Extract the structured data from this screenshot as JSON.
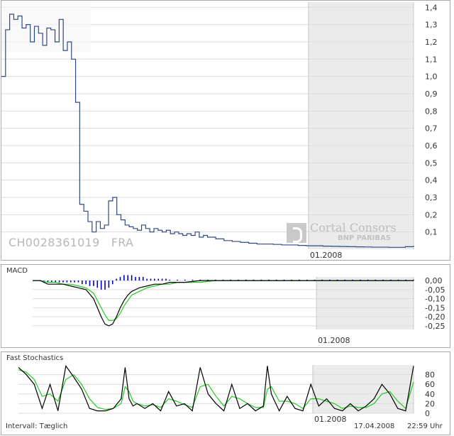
{
  "instrument": {
    "isin": "CH0028361019",
    "exchange": "FRA"
  },
  "brand": {
    "name": "Cortal Consors",
    "sub": "BNP PARIBAS"
  },
  "footer": {
    "interval": "Intervall: Tæglich",
    "date": "17.04.2008",
    "time": "22:59 Uhr"
  },
  "colors": {
    "price": "#2e4a86",
    "macd": "#000000",
    "signal": "#22cc22",
    "hist": "#0000cc",
    "stoch_k": "#000000",
    "stoch_d": "#22cc22",
    "future": "#ebebeb"
  },
  "chart_data": [
    {
      "type": "line",
      "name": "price",
      "x_start": 0,
      "x_end": 100,
      "date_marker": {
        "x": 74.5,
        "label": "01.2008"
      },
      "ylim": [
        0,
        1.43
      ],
      "yticks": [
        "0,1",
        "0,2",
        "0,3",
        "0,4",
        "0,5",
        "0,6",
        "0,7",
        "0,8",
        "0,9",
        "1,0",
        "1,1",
        "1,2",
        "1,3",
        "1,4"
      ],
      "ytick_values": [
        0.1,
        0.2,
        0.3,
        0.4,
        0.5,
        0.6,
        0.7,
        0.8,
        0.9,
        1.0,
        1.1,
        1.2,
        1.3,
        1.4
      ],
      "x": [
        0,
        1,
        2,
        3,
        4,
        5,
        6,
        7,
        8,
        9,
        10,
        11,
        12,
        13,
        14,
        15,
        16,
        17,
        18,
        19,
        20,
        21,
        22,
        23,
        24,
        25,
        26,
        27,
        28,
        29,
        30,
        31,
        32,
        33,
        34,
        35,
        36,
        37,
        38,
        39,
        40,
        41,
        42,
        43,
        44,
        45,
        46,
        47,
        48,
        49,
        50,
        52,
        54,
        56,
        58,
        60,
        62,
        64,
        66,
        68,
        70,
        72,
        74,
        76,
        78,
        80,
        82,
        84,
        86,
        88,
        90,
        92,
        94,
        96,
        98,
        100
      ],
      "values": [
        1.0,
        1.27,
        1.36,
        1.33,
        1.35,
        1.28,
        1.3,
        1.2,
        1.29,
        1.25,
        1.18,
        1.28,
        1.27,
        1.2,
        1.33,
        1.15,
        1.2,
        1.1,
        0.85,
        0.26,
        0.22,
        0.16,
        0.1,
        0.16,
        0.12,
        0.14,
        0.28,
        0.3,
        0.2,
        0.17,
        0.14,
        0.13,
        0.12,
        0.11,
        0.14,
        0.12,
        0.1,
        0.12,
        0.11,
        0.1,
        0.11,
        0.09,
        0.1,
        0.09,
        0.08,
        0.09,
        0.08,
        0.1,
        0.07,
        0.08,
        0.07,
        0.06,
        0.05,
        0.045,
        0.04,
        0.035,
        0.03,
        0.03,
        0.028,
        0.025,
        0.025,
        0.022,
        0.02,
        0.02,
        0.018,
        0.017,
        0.016,
        0.015,
        0.014,
        0.013,
        0.012,
        0.012,
        0.011,
        0.011,
        0.015,
        0.02
      ]
    },
    {
      "type": "line",
      "name": "MACD",
      "title": "MACD",
      "ylim": [
        -0.27,
        0.02
      ],
      "yticks": [
        "0,00",
        "-0,05",
        "-0,10",
        "-0,15",
        "-0,20",
        "-0,25"
      ],
      "ytick_values": [
        0.0,
        -0.05,
        -0.1,
        -0.15,
        -0.2,
        -0.25
      ],
      "x": [
        0,
        2,
        4,
        6,
        8,
        10,
        12,
        14,
        16,
        17,
        18,
        19,
        20,
        21,
        22,
        23,
        24,
        25,
        26,
        27,
        28,
        30,
        32,
        34,
        36,
        38,
        40,
        44,
        48,
        52,
        56,
        60,
        66,
        72,
        78,
        84,
        90,
        96,
        100
      ],
      "macd": [
        0.0,
        0.0,
        -0.02,
        -0.02,
        -0.02,
        -0.03,
        -0.04,
        -0.05,
        -0.1,
        -0.15,
        -0.2,
        -0.24,
        -0.25,
        -0.24,
        -0.2,
        -0.15,
        -0.11,
        -0.08,
        -0.06,
        -0.05,
        -0.04,
        -0.03,
        -0.02,
        -0.02,
        -0.01,
        -0.01,
        -0.01,
        0.0,
        0.0,
        0.0,
        0.0,
        0.0,
        0.0,
        0.0,
        0.0,
        0.0,
        0.0,
        0.0,
        0.0
      ],
      "signal": [
        0.0,
        0.0,
        -0.01,
        -0.01,
        -0.02,
        -0.02,
        -0.03,
        -0.04,
        -0.07,
        -0.11,
        -0.15,
        -0.19,
        -0.22,
        -0.22,
        -0.21,
        -0.18,
        -0.14,
        -0.11,
        -0.08,
        -0.07,
        -0.06,
        -0.04,
        -0.03,
        -0.02,
        -0.02,
        -0.01,
        -0.01,
        -0.01,
        0.0,
        0.0,
        0.0,
        0.0,
        0.0,
        0.0,
        0.0,
        0.0,
        0.0,
        0.0,
        0.0
      ],
      "hist_x": [
        2,
        3,
        4,
        5,
        6,
        7,
        8,
        9,
        10,
        11,
        12,
        13,
        14,
        15,
        16,
        17,
        18,
        19,
        20,
        21,
        22,
        23,
        24,
        25,
        26,
        27,
        28,
        29,
        30,
        31,
        32,
        33,
        34,
        35,
        36,
        38,
        40,
        42,
        44,
        46,
        48,
        50,
        52,
        54,
        56,
        58,
        60,
        62,
        64,
        66,
        68,
        70,
        72,
        74,
        76,
        78,
        80,
        82,
        84,
        86,
        88,
        90,
        92,
        94,
        96,
        98,
        100
      ],
      "hist": [
        0.0,
        -0.01,
        -0.01,
        -0.01,
        -0.01,
        -0.01,
        -0.01,
        -0.01,
        -0.01,
        -0.01,
        -0.01,
        -0.02,
        -0.02,
        -0.03,
        -0.03,
        -0.04,
        -0.05,
        -0.05,
        -0.04,
        -0.02,
        0.01,
        0.02,
        0.03,
        0.03,
        0.03,
        0.02,
        0.02,
        0.02,
        0.01,
        0.01,
        0.01,
        0.01,
        0.01,
        0.01,
        0.005,
        0.005,
        0.005,
        0.005,
        0.005,
        0.005,
        0.005,
        0.005,
        0.005,
        0.005,
        0.005,
        0.005,
        0.005,
        0.005,
        0.005,
        0.005,
        0.005,
        0.005,
        0.005,
        0.005,
        0.005,
        0.005,
        0.005,
        0.005,
        0.005,
        0.005,
        0.005,
        0.005,
        0.005,
        0.005,
        0.005,
        0.005,
        0.005
      ]
    },
    {
      "type": "line",
      "name": "Fast Stochastics",
      "title": "Fast Stochastics",
      "ylim": [
        0,
        100
      ],
      "yticks": [
        "0",
        "20",
        "40",
        "60",
        "80"
      ],
      "ytick_values": [
        0,
        20,
        40,
        60,
        80
      ],
      "x": [
        0,
        2,
        4,
        6,
        8,
        10,
        12,
        14,
        16,
        18,
        20,
        22,
        24,
        26,
        27,
        28,
        29,
        30,
        32,
        34,
        36,
        38,
        40,
        42,
        44,
        46,
        48,
        50,
        52,
        54,
        56,
        58,
        60,
        62,
        63,
        64,
        66,
        68,
        70,
        72,
        74,
        76,
        78,
        80,
        82,
        84,
        86,
        88,
        90,
        92,
        94,
        96,
        98,
        100
      ],
      "k": [
        95,
        80,
        60,
        10,
        60,
        5,
        98,
        75,
        50,
        10,
        5,
        5,
        10,
        30,
        95,
        30,
        15,
        20,
        10,
        20,
        5,
        45,
        15,
        20,
        5,
        95,
        40,
        20,
        5,
        60,
        10,
        20,
        5,
        15,
        98,
        40,
        5,
        35,
        10,
        5,
        60,
        15,
        30,
        10,
        5,
        20,
        5,
        15,
        30,
        60,
        40,
        10,
        5,
        98
      ],
      "d": [
        90,
        85,
        70,
        35,
        40,
        25,
        70,
        80,
        60,
        30,
        12,
        8,
        10,
        20,
        55,
        45,
        25,
        20,
        15,
        18,
        12,
        30,
        25,
        18,
        12,
        55,
        60,
        35,
        15,
        35,
        30,
        20,
        12,
        12,
        50,
        55,
        25,
        25,
        20,
        10,
        30,
        30,
        25,
        20,
        10,
        15,
        12,
        12,
        20,
        40,
        45,
        25,
        10,
        65
      ]
    }
  ]
}
